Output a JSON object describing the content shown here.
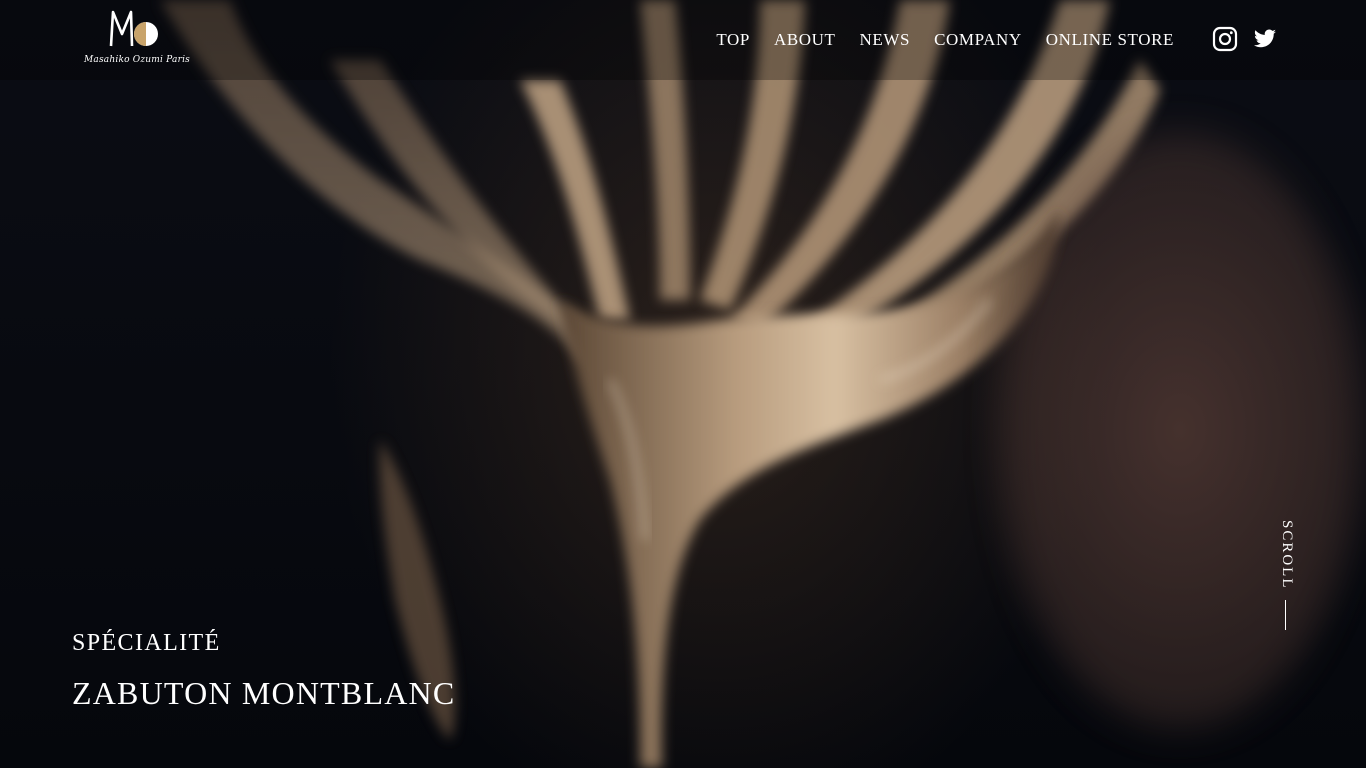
{
  "header": {
    "logo": {
      "mark": "Mo",
      "text": "Masahiko Ozumi Paris"
    },
    "nav": [
      {
        "label": "TOP"
      },
      {
        "label": "ABOUT"
      },
      {
        "label": "NEWS"
      },
      {
        "label": "COMPANY"
      },
      {
        "label": "ONLINE STORE"
      }
    ],
    "social": [
      {
        "icon": "instagram-icon"
      },
      {
        "icon": "twitter-icon"
      }
    ]
  },
  "hero": {
    "subtitle": "SPÉCIALITÉ",
    "title": "ZABUTON MONTBLANC"
  },
  "scroll": {
    "label": "SCROLL"
  },
  "colors": {
    "text": "#ffffff",
    "background": "#07090f",
    "cream": "#b89a7a",
    "gold": "#c8a36a"
  }
}
